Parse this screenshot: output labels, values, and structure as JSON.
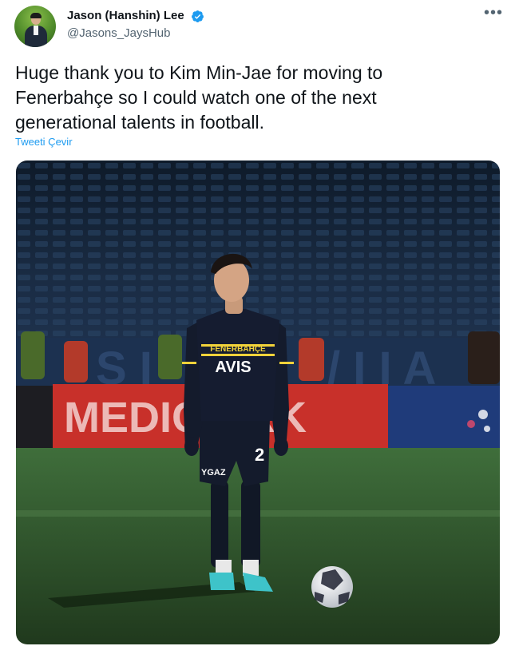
{
  "author": {
    "display_name": "Jason (Hanshin) Lee",
    "handle": "@Jasons_JaysHub",
    "verified": true
  },
  "tweet": {
    "text_lines": [
      "Huge thank you to Kim Min-Jae for moving to",
      "Fenerbahçe so I could watch one of the next",
      "generational talents in football."
    ],
    "translate_label": "Tweeti Çevir"
  },
  "icons": {
    "more": "more-options-icon",
    "verified": "verified-badge-icon"
  },
  "media": {
    "shirt_sponsor": "AVIS",
    "shirt_club": "FENERBAHÇE",
    "board_text": "MEDICAL PARK",
    "shorts_number": "2",
    "shorts_sponsor": "YGAZ"
  },
  "colors": {
    "link": "#1d9bf0",
    "verified": "#1d9bf0",
    "text": "#0f1419",
    "secondary": "#536471"
  }
}
